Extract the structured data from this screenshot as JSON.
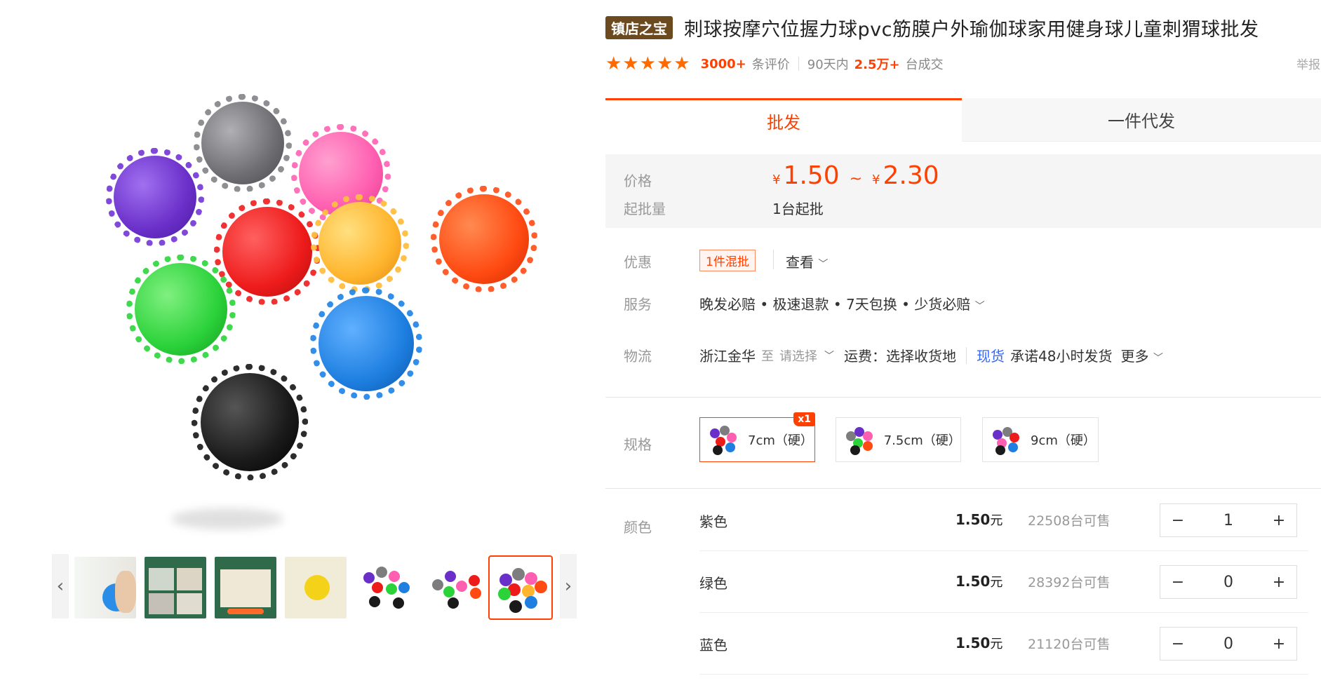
{
  "product": {
    "badge": "镇店之宝",
    "title": "刺球按摩穴位握力球pvc筋膜户外瑜伽球家用健身球儿童刺猬球批发",
    "rating_stars": 5,
    "review_count": "3000+",
    "review_suffix": "条评价",
    "sales_prefix": "90天内",
    "sales_count": "2.5万+",
    "sales_suffix": "台成交",
    "report_label": "举报"
  },
  "tabs": {
    "wholesale": "批发",
    "dropship": "一件代发"
  },
  "price": {
    "label": "价格",
    "currency": "¥",
    "low": "1.50",
    "high": "2.30",
    "tilde": "~",
    "moq_label": "起批量",
    "moq_value": "1台起批"
  },
  "promo": {
    "label": "优惠",
    "tag": "1件混批",
    "view": "查看"
  },
  "service": {
    "label": "服务",
    "text": "晚发必赔 • 极速退款 • 7天包换 • 少货必赔"
  },
  "logistics": {
    "label": "物流",
    "origin": "浙江金华",
    "to": "至",
    "dest": "请选择",
    "fee": "运费：选择收货地",
    "stock_tag": "现货",
    "promise": "承诺48小时发货",
    "more": "更多"
  },
  "spec": {
    "label": "规格",
    "badge": "x1",
    "options": [
      {
        "label": "7cm（硬）"
      },
      {
        "label": "7.5cm（硬）"
      },
      {
        "label": "9cm（硬）"
      }
    ]
  },
  "color": {
    "label": "颜色",
    "unit": "元",
    "rows": [
      {
        "name": "紫色",
        "price": "1.50",
        "stock": "22508台可售",
        "qty": "1"
      },
      {
        "name": "绿色",
        "price": "1.50",
        "stock": "28392台可售",
        "qty": "0"
      },
      {
        "name": "蓝色",
        "price": "1.50",
        "stock": "21120台可售",
        "qty": "0"
      }
    ],
    "minus": "−",
    "plus": "+"
  },
  "colors": {
    "accent": "#ff4000",
    "badge_bg": "#6b4a1f",
    "purple": "#6a2fc9",
    "gray": "#7d7d80",
    "pink": "#ff5fb0",
    "red": "#ee1b1b",
    "yellow": "#ffb52e",
    "orange": "#ff4a12",
    "green": "#2bd23a",
    "blue": "#1e7fe0",
    "black": "#1a1a1a"
  },
  "icons": {
    "star": "★",
    "chevron_down": "﹀",
    "arrow_left": "‹",
    "arrow_right": "›"
  }
}
